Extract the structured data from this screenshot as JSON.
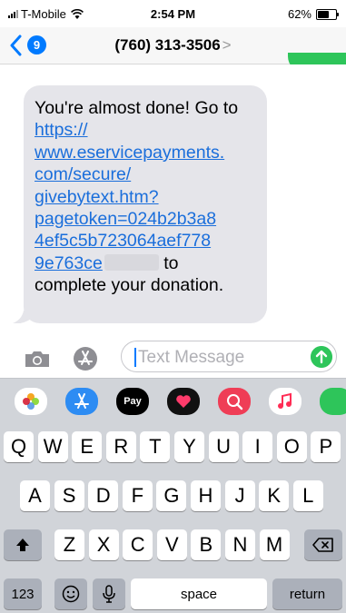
{
  "status_bar": {
    "carrier": "T-Mobile",
    "time": "2:54 PM",
    "battery": "62%",
    "battery_level": 0.62
  },
  "nav": {
    "back_badge": "9",
    "contact": "(760) 313-3506",
    "chevron": ">"
  },
  "message": {
    "text_before": "You're almost done! Go to ",
    "url": "https://\nwww.eservicepayments.\ncom/secure/\ngivebytext.htm?\npagetoken=024b2b3a8\n4ef5c5b723064aef778\n9e763ce",
    "text_after": " to\ncomplete your donation."
  },
  "input": {
    "placeholder": "Text Message"
  },
  "apps": [
    {
      "name": "photos-app-icon",
      "color": "#ffffff"
    },
    {
      "name": "appstore-app-icon",
      "color": "#2d8cf3"
    },
    {
      "name": "apple-pay-app-icon",
      "color": "#000000",
      "label": "Pay"
    },
    {
      "name": "digital-touch-app-icon",
      "color": "#111111"
    },
    {
      "name": "web-images-app-icon",
      "color": "#ef3d56"
    },
    {
      "name": "music-app-icon",
      "color": "#ffffff"
    },
    {
      "name": "green-app-icon",
      "color": "#2ec55a"
    }
  ],
  "keyboard": {
    "row1": [
      "Q",
      "W",
      "E",
      "R",
      "T",
      "Y",
      "U",
      "I",
      "O",
      "P"
    ],
    "row2": [
      "A",
      "S",
      "D",
      "F",
      "G",
      "H",
      "J",
      "K",
      "L"
    ],
    "row3": [
      "Z",
      "X",
      "C",
      "V",
      "B",
      "N",
      "M"
    ],
    "numbers_key": "123",
    "space_key": "space",
    "return_key": "return"
  }
}
